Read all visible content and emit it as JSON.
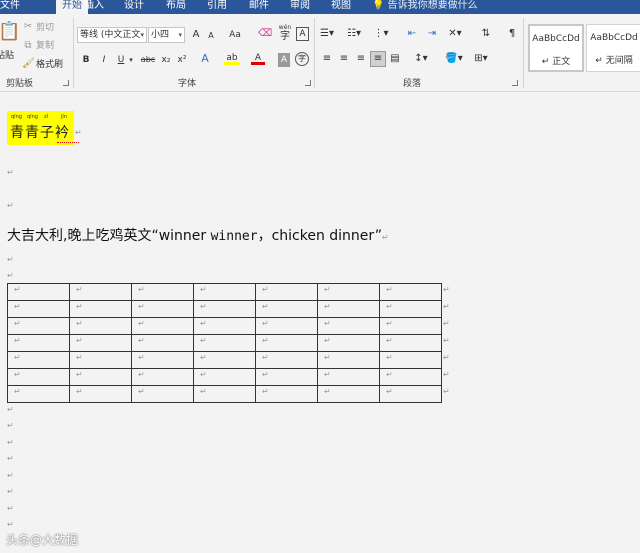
{
  "tabs": [
    {
      "id": "file",
      "label": "文件"
    },
    {
      "id": "home",
      "label": "开始",
      "active": true
    },
    {
      "id": "insert",
      "label": "插入"
    },
    {
      "id": "design",
      "label": "设计"
    },
    {
      "id": "layout",
      "label": "布局"
    },
    {
      "id": "references",
      "label": "引用"
    },
    {
      "id": "mailings",
      "label": "邮件"
    },
    {
      "id": "review",
      "label": "审阅"
    },
    {
      "id": "view",
      "label": "视图"
    }
  ],
  "tell_me": "告诉我你想要做什么",
  "clipboard": {
    "paste_label": "粘贴",
    "cut_label": "剪切",
    "copy_label": "复制",
    "format_painter_label": "格式刷",
    "group_label": "剪贴板"
  },
  "font": {
    "family": "等线 (中文正文",
    "size": "小四",
    "group_label": "字体",
    "grow": "A",
    "shrink": "A",
    "case": "Aa",
    "phonetic": "wén",
    "phonetic_char": "字",
    "border_char": "A",
    "bold": "B",
    "italic": "I",
    "underline": "U",
    "strike": "abc",
    "subscript": "x₂",
    "superscript": "x²",
    "effects": "A",
    "highlight": "ab",
    "color": "A",
    "shading": "A",
    "circle": "字"
  },
  "paragraph": {
    "group_label": "段落"
  },
  "styles": [
    {
      "sample": "AaBbCcDd",
      "name": "↵ 正文"
    },
    {
      "sample": "AaBbCcDd",
      "name": "↵ 无间隔"
    }
  ],
  "colors": {
    "ribbon_blue": "#2b579a",
    "highlight_yellow": "#ffff00",
    "font_red": "#e00000"
  },
  "document": {
    "pilcrow": "↵",
    "title_text": "青青子衿",
    "title_pinyin": [
      "qīng",
      "qīng",
      "zǐ",
      "jīn"
    ],
    "sentence_part1": "大吉大利,晚上吃鸡英文“winner ",
    "sentence_mono": "winner",
    "sentence_part2": "，chicken dinner”",
    "table": {
      "rows": 7,
      "cols": 7
    }
  },
  "watermark": "头条@大数据"
}
